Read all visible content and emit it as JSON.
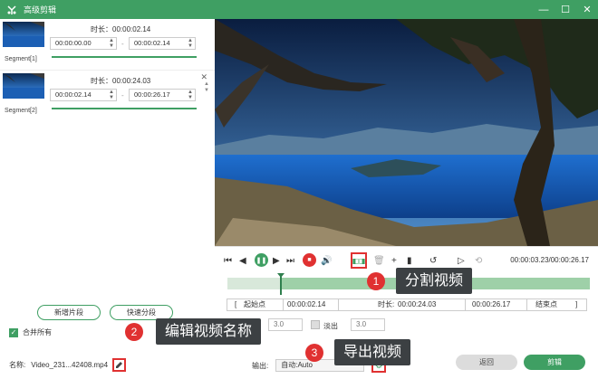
{
  "window": {
    "title": "高级剪辑",
    "min_glyph": "—",
    "max_glyph": "☐",
    "close_glyph": "✕"
  },
  "segments": [
    {
      "label": "Segment[1]",
      "duration": "时长：00:00:02.14",
      "start": "00:00:00.00",
      "end": "00:00:02.14"
    },
    {
      "label": "Segment[2]",
      "duration": "时长：00:00:24.03",
      "start": "00:00:02.14",
      "end": "00:00:26.17"
    }
  ],
  "left_actions": {
    "new_segment": "新增片段",
    "quick_split": "快速分段",
    "merge_all": "合并所有"
  },
  "name_row": {
    "label": "名称:",
    "value": "Video_231...42408.mp4"
  },
  "output_row": {
    "label": "输出:",
    "value": "自动:Auto"
  },
  "playback": {
    "time_display": "00:00:03.23/00:00:26.17",
    "progress": 0.13
  },
  "trim": {
    "start_btn": "起始点",
    "start_value": "00:00:02.14",
    "duration_label": "时长:",
    "duration_value": "00:00:24.03",
    "end_value": "00:00:26.17",
    "end_btn": "结束点"
  },
  "fade": {
    "fade_in_value": "3.0",
    "fade_out_label": "淡出",
    "fade_out_value": "3.0"
  },
  "buttons": {
    "back": "返回",
    "cut": "剪辑"
  },
  "annotations": [
    {
      "num": "1",
      "text": "分割视频"
    },
    {
      "num": "2",
      "text": "编辑视频名称"
    },
    {
      "num": "3",
      "text": "导出视频"
    }
  ],
  "colors": {
    "accent": "#3f9f63",
    "highlight": "#e03131"
  }
}
